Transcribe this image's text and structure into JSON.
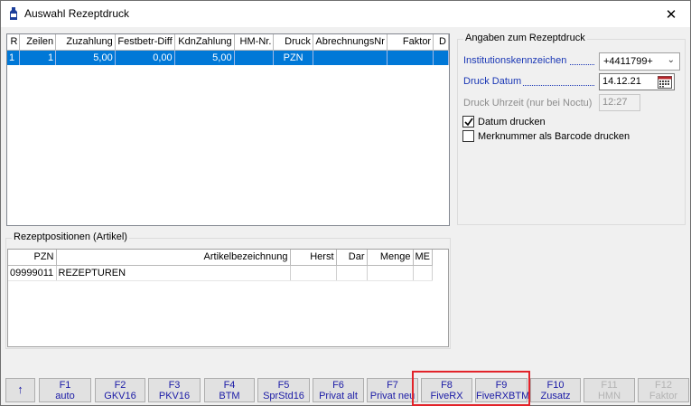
{
  "window": {
    "title": "Auswahl Rezeptdruck",
    "close_glyph": "✕"
  },
  "upper_grid": {
    "columns": [
      "R",
      "Zeilen",
      "Zuzahlung",
      "Festbetr-Diff",
      "KdnZahlung",
      "HM-Nr.",
      "Druck",
      "AbrechnungsNr",
      "Faktor",
      "D"
    ],
    "rows": [
      [
        "1",
        "1",
        "5,00",
        "0,00",
        "5,00",
        "",
        "PZN",
        "",
        "",
        ""
      ]
    ]
  },
  "details": {
    "group_title": "Angaben zum Rezeptdruck",
    "institution_label": "Institutionskennzeichen",
    "institution_value": "+4411799+",
    "druck_datum_label": "Druck Datum",
    "druck_datum_value": "14.12.21",
    "druck_uhrzeit_label": "Druck Uhrzeit (nur bei Noctu)",
    "druck_uhrzeit_value": "12:27",
    "datum_drucken_label": "Datum drucken",
    "datum_drucken_checked": true,
    "merknummer_label": "Merknummer als Barcode drucken",
    "merknummer_checked": false
  },
  "positions": {
    "group_title": "Rezeptpositionen (Artikel)",
    "columns": [
      "PZN",
      "Artikelbezeichnung",
      "Herst",
      "Dar",
      "Menge",
      "ME"
    ],
    "rows": [
      [
        "09999011",
        "REZEPTUREN",
        "",
        "",
        "",
        ""
      ]
    ]
  },
  "function_keys": [
    {
      "key": "↑",
      "label": "",
      "enabled": true
    },
    {
      "key": "F1",
      "label": "auto",
      "enabled": true
    },
    {
      "key": "F2",
      "label": "GKV16",
      "enabled": true
    },
    {
      "key": "F3",
      "label": "PKV16",
      "enabled": true
    },
    {
      "key": "F4",
      "label": "BTM",
      "enabled": true
    },
    {
      "key": "F5",
      "label": "SprStd16",
      "enabled": true
    },
    {
      "key": "F6",
      "label": "Privat alt",
      "enabled": true
    },
    {
      "key": "F7",
      "label": "Privat neu",
      "enabled": true
    },
    {
      "key": "F8",
      "label": "FiveRX",
      "enabled": true
    },
    {
      "key": "F9",
      "label": "FiveRXBTM",
      "enabled": true
    },
    {
      "key": "F10",
      "label": "Zusatz",
      "enabled": true
    },
    {
      "key": "F11",
      "label": "HMN",
      "enabled": false
    },
    {
      "key": "F12",
      "label": "Faktor",
      "enabled": false
    }
  ],
  "colors": {
    "selection": "#0078d7",
    "link_blue": "#1a37b5",
    "highlight_red": "#e2232a"
  }
}
